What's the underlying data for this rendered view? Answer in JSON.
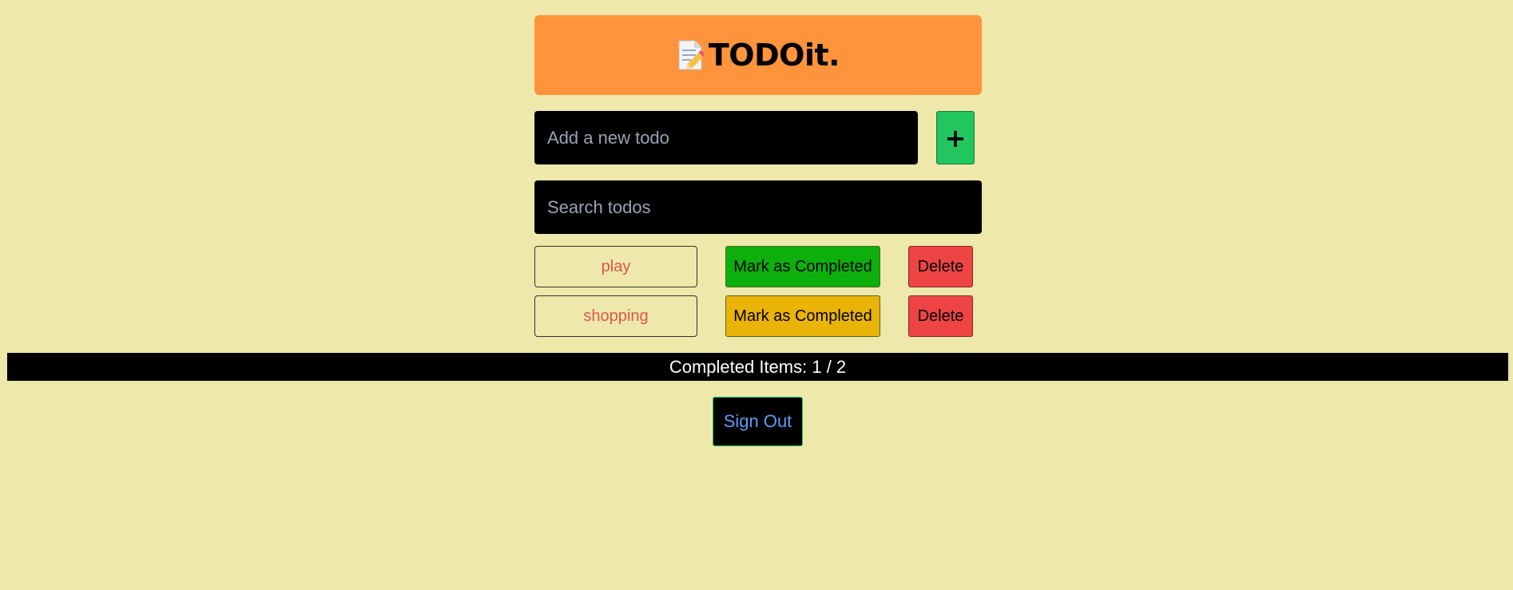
{
  "header": {
    "title": "TODOit.",
    "logo_icon": "memo-pencil-icon"
  },
  "add": {
    "placeholder": "Add a new todo",
    "button_label": "+"
  },
  "search": {
    "placeholder": "Search todos"
  },
  "todos": [
    {
      "text": "play",
      "complete_label": "Mark as Completed",
      "complete_color": "#0CAF0C",
      "delete_label": "Delete"
    },
    {
      "text": "shopping",
      "complete_label": "Mark as Completed",
      "complete_color": "#EAB308",
      "delete_label": "Delete"
    }
  ],
  "status": {
    "text": "Completed Items: 1 / 2"
  },
  "signout": {
    "label": "Sign Out"
  },
  "colors": {
    "background": "#EEE8AA",
    "header": "#FF943C",
    "add_button": "#22C55E",
    "delete_button": "#EF4444",
    "todo_text": "#e0544b",
    "signout_text": "#5b9cf5"
  }
}
